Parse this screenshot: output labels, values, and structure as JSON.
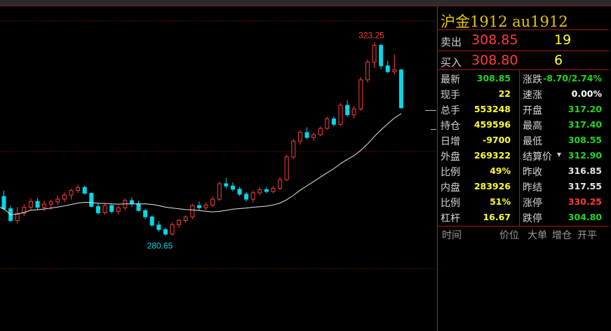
{
  "header": {
    "title": "沪金1912 au1912"
  },
  "orderbook": {
    "sell": {
      "label": "卖出",
      "price": "308.85",
      "volume": "19"
    },
    "buy": {
      "label": "买入",
      "price": "308.80",
      "volume": "6"
    }
  },
  "quote_rows": [
    {
      "l1": "最新",
      "v1": "308.85",
      "c1": "#22d622",
      "l2": "涨跌",
      "v2": "-8.70/2.74%",
      "c2": "#22d622"
    },
    {
      "l1": "现手",
      "v1": "22",
      "c1": "#ffff33",
      "l2": "速涨",
      "v2": "0.00%",
      "c2": "#ffffff"
    },
    {
      "l1": "总手",
      "v1": "553248",
      "c1": "#ffff33",
      "l2": "开盘",
      "v2": "317.20",
      "c2": "#22d622"
    },
    {
      "l1": "持仓",
      "v1": "459596",
      "c1": "#ffff33",
      "l2": "最高",
      "v2": "317.40",
      "c2": "#22d622"
    },
    {
      "l1": "日增",
      "v1": "-9700",
      "c1": "#ffff33",
      "l2": "最低",
      "v2": "308.55",
      "c2": "#22d622"
    },
    {
      "l1": "外盘",
      "v1": "269322",
      "c1": "#ffff33",
      "l2": "结算价",
      "v2": "312.90",
      "c2": "#22d622"
    },
    {
      "l1": "比例",
      "v1": "49%",
      "c1": "#ffff33",
      "l2": "昨收",
      "v2": "316.85",
      "c2": "#e6e6e6"
    },
    {
      "l1": "内盘",
      "v1": "283926",
      "c1": "#ffff33",
      "l2": "昨结",
      "v2": "317.55",
      "c2": "#e6e6e6"
    },
    {
      "l1": "比例",
      "v1": "51%",
      "c1": "#ffff33",
      "l2": "涨停",
      "v2": "330.25",
      "c2": "#ff3b3b"
    },
    {
      "l1": "杠杆",
      "v1": "16.67",
      "c1": "#ffff33",
      "l2": "跌停",
      "v2": "304.80",
      "c2": "#22d622"
    }
  ],
  "trades_header": {
    "time": "时间",
    "price": "价位",
    "size": "大单",
    "oi": "增仓",
    "open": "开平"
  },
  "chart_data": {
    "type": "candlestick",
    "high_label": "323.25",
    "low_label": "280.65",
    "colors": {
      "up": "#ff3b3b",
      "down": "#00d8e8",
      "ma": "#e8e8e8"
    },
    "candles": [
      [
        289.3,
        290.6,
        286.2,
        286.6
      ],
      [
        286.6,
        287.3,
        283.6,
        284.0
      ],
      [
        284.0,
        287.0,
        283.3,
        285.6
      ],
      [
        285.6,
        287.6,
        285.0,
        286.9
      ],
      [
        286.9,
        288.9,
        286.2,
        288.2
      ],
      [
        288.2,
        289.0,
        286.4,
        286.9
      ],
      [
        286.9,
        288.4,
        286.1,
        287.6
      ],
      [
        287.6,
        288.6,
        286.4,
        288.1
      ],
      [
        288.1,
        289.5,
        287.4,
        288.7
      ],
      [
        288.7,
        290.2,
        288.0,
        289.6
      ],
      [
        289.6,
        291.0,
        288.6,
        290.6
      ],
      [
        290.6,
        291.9,
        290.0,
        291.3
      ],
      [
        291.3,
        291.7,
        289.7,
        290.0
      ],
      [
        290.0,
        290.2,
        286.9,
        287.1
      ],
      [
        287.1,
        287.9,
        285.3,
        285.7
      ],
      [
        285.7,
        287.7,
        285.3,
        287.3
      ],
      [
        287.3,
        287.6,
        285.5,
        286.0
      ],
      [
        286.0,
        287.3,
        285.4,
        286.8
      ],
      [
        286.8,
        288.9,
        286.2,
        288.4
      ],
      [
        288.4,
        289.1,
        287.0,
        287.7
      ],
      [
        287.7,
        288.4,
        286.0,
        286.2
      ],
      [
        286.2,
        286.6,
        284.3,
        284.8
      ],
      [
        284.8,
        285.1,
        282.6,
        283.0
      ],
      [
        283.0,
        283.9,
        281.5,
        282.0
      ],
      [
        282.0,
        282.4,
        280.6,
        281.0
      ],
      [
        281.0,
        283.6,
        280.7,
        283.1
      ],
      [
        283.1,
        284.4,
        282.4,
        284.0
      ],
      [
        284.0,
        285.2,
        283.5,
        284.8
      ],
      [
        284.8,
        287.7,
        284.3,
        287.3
      ],
      [
        287.3,
        288.2,
        286.2,
        286.8
      ],
      [
        286.8,
        288.0,
        286.3,
        287.4
      ],
      [
        287.4,
        289.2,
        287.0,
        288.7
      ],
      [
        288.7,
        292.6,
        288.3,
        292.1
      ],
      [
        292.1,
        293.4,
        291.0,
        291.6
      ],
      [
        291.6,
        292.4,
        290.4,
        290.9
      ],
      [
        290.9,
        291.4,
        289.4,
        289.8
      ],
      [
        289.8,
        290.3,
        288.2,
        288.7
      ],
      [
        288.7,
        290.6,
        288.0,
        290.1
      ],
      [
        290.1,
        291.3,
        289.6,
        290.8
      ],
      [
        290.8,
        291.4,
        290.0,
        290.4
      ],
      [
        290.4,
        291.6,
        290.0,
        291.1
      ],
      [
        291.1,
        293.6,
        290.8,
        293.0
      ],
      [
        293.0,
        298.5,
        292.7,
        298.0
      ],
      [
        298.0,
        302.0,
        297.5,
        301.5
      ],
      [
        301.5,
        303.9,
        300.7,
        303.4
      ],
      [
        303.4,
        304.5,
        301.9,
        302.3
      ],
      [
        302.3,
        303.4,
        301.6,
        302.9
      ],
      [
        302.9,
        304.7,
        302.6,
        304.3
      ],
      [
        304.3,
        306.9,
        304.0,
        306.4
      ],
      [
        306.4,
        307.0,
        304.7,
        305.2
      ],
      [
        305.2,
        309.9,
        304.9,
        309.4
      ],
      [
        309.4,
        310.5,
        306.8,
        307.3
      ],
      [
        307.3,
        309.2,
        306.5,
        308.6
      ],
      [
        308.6,
        315.6,
        308.2,
        315.0
      ],
      [
        315.0,
        319.5,
        314.4,
        318.9
      ],
      [
        318.9,
        323.25,
        317.6,
        322.6
      ],
      [
        322.6,
        323.0,
        317.4,
        318.1
      ],
      [
        318.1,
        319.2,
        316.4,
        316.8
      ],
      [
        316.8,
        320.6,
        316.2,
        317.2
      ],
      [
        317.2,
        317.4,
        308.55,
        308.85
      ]
    ]
  }
}
